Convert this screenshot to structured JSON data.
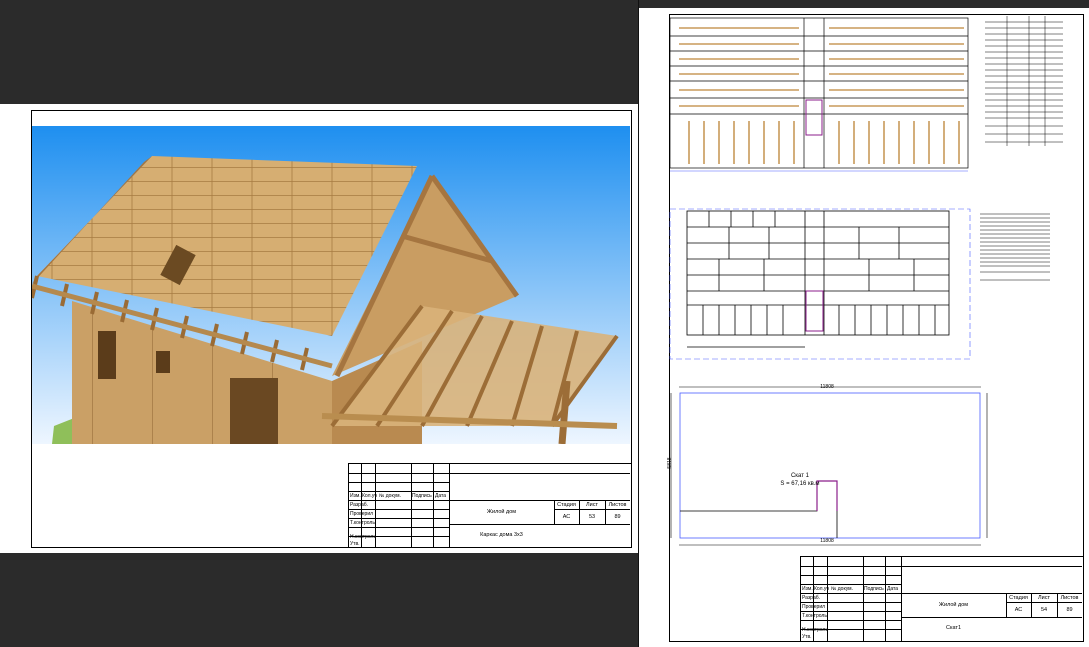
{
  "sheet_left": {
    "title_block": {
      "col_headers": [
        "Изм.",
        "Кол.уч",
        "№ докум.",
        "Подпись",
        "Дата"
      ],
      "rows": [
        "Разраб.",
        "Проверил",
        "Т.контроль",
        "",
        "Н.контроль",
        "Утв."
      ],
      "project": "Жилой дом",
      "drawing": "Каркас дома 3х3",
      "stage_label": "Стадия",
      "sheet_label": "Лист",
      "sheets_label": "Листов",
      "stage": "АС",
      "sheet": "53",
      "sheets": "89"
    }
  },
  "sheet_right": {
    "plan": {
      "caption_line1": "Скат 1",
      "caption_line2": "S = 67,16 кв.м",
      "dim_top": "11808",
      "dim_bottom": "11808",
      "dim_side": "5818"
    },
    "title_block": {
      "col_headers": [
        "Изм.",
        "Кол.уч",
        "№ докум.",
        "Подпись",
        "Дата"
      ],
      "rows": [
        "Разраб.",
        "Проверил",
        "Т.контроль",
        "",
        "Н.контроль",
        "Утв."
      ],
      "project": "Жилой дом",
      "drawing": "Скат1",
      "stage_label": "Стадия",
      "sheet_label": "Лист",
      "sheets_label": "Листов",
      "stage": "АС",
      "sheet": "54",
      "sheets": "89"
    }
  },
  "colors": {
    "background": "#2b2b2b",
    "sky_top": "#1e8ff0",
    "sky_bottom": "#eef6ff",
    "wood": "#c89a5a",
    "wood_dark": "#8a5e2c",
    "osb": "#d8b27a",
    "frame_blue": "#4a5cff",
    "accent_purple": "#8b1e8b"
  }
}
